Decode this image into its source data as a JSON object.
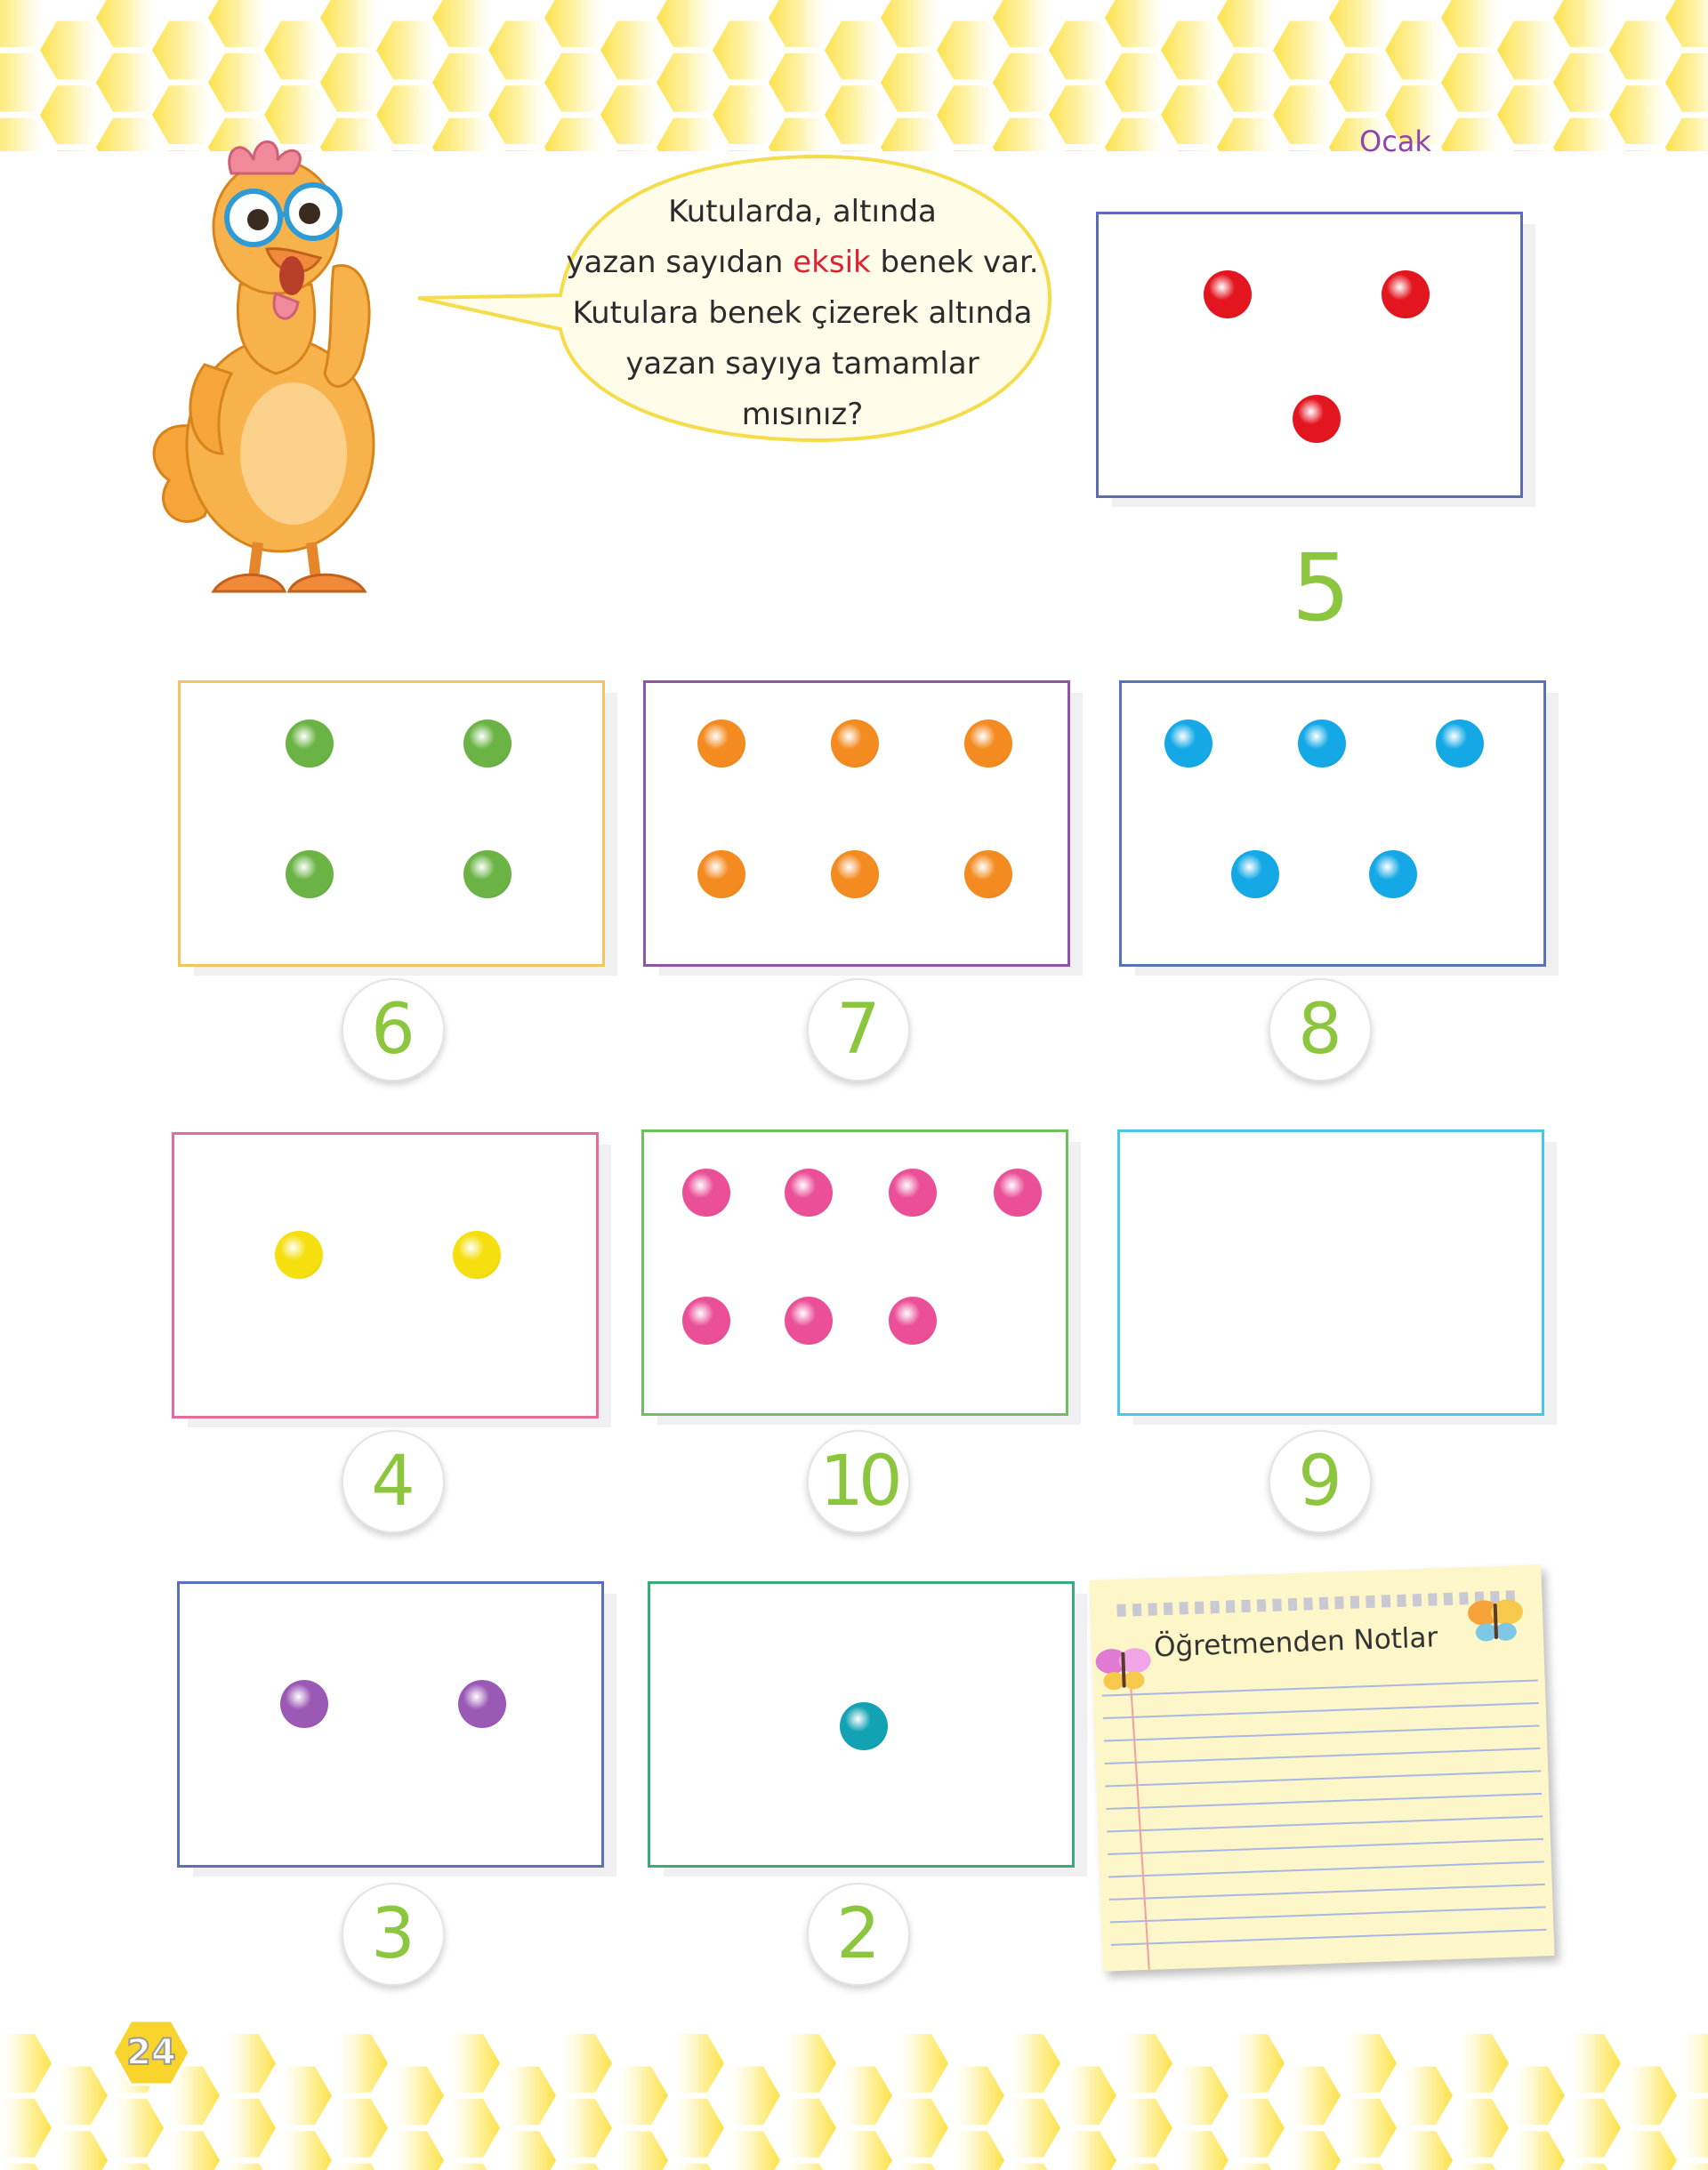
{
  "header": {
    "month": "Ocak"
  },
  "instruction": {
    "line1": "Kutularda, altında",
    "line2_before": "yazan sayıdan ",
    "line2_highlight": "eksik",
    "line2_after": " benek var.",
    "line3": "Kutulara benek çizerek altında",
    "line4": "yazan sayıya tamamlar",
    "line5": "mısınız?"
  },
  "example": {
    "number": "5",
    "dot_count": 3,
    "dot_color": "#e3161f",
    "border_color": "#5b6bb5"
  },
  "boxes": [
    {
      "number": "6",
      "dot_count": 4,
      "dot_color": "#6ab344",
      "border_color": "#f7c35f"
    },
    {
      "number": "7",
      "dot_count": 6,
      "dot_color": "#f38b21",
      "border_color": "#8e55a6"
    },
    {
      "number": "8",
      "dot_count": 5,
      "dot_color": "#14a9e6",
      "border_color": "#5a70b8"
    },
    {
      "number": "4",
      "dot_count": 2,
      "dot_color": "#f5df0e",
      "border_color": "#e9699c"
    },
    {
      "number": "10",
      "dot_count": 7,
      "dot_color": "#ea4f98",
      "border_color": "#6fbf5f"
    },
    {
      "number": "9",
      "dot_count": 0,
      "dot_color": "#14a9e6",
      "border_color": "#4cc4ec"
    },
    {
      "number": "3",
      "dot_count": 2,
      "dot_color": "#9b59b6",
      "border_color": "#5a70b8"
    },
    {
      "number": "2",
      "dot_count": 1,
      "dot_color": "#11a2b3",
      "border_color": "#3aab78"
    }
  ],
  "notes": {
    "title": "Öğretmenden Notlar"
  },
  "footer": {
    "page_number": "24"
  },
  "colors": {
    "honeycomb": "#fde96b",
    "number_green": "#8cc63f",
    "highlight_red": "#e02030"
  },
  "icons": {
    "character": "chicken-character",
    "note_decor": "butterfly-icon"
  }
}
